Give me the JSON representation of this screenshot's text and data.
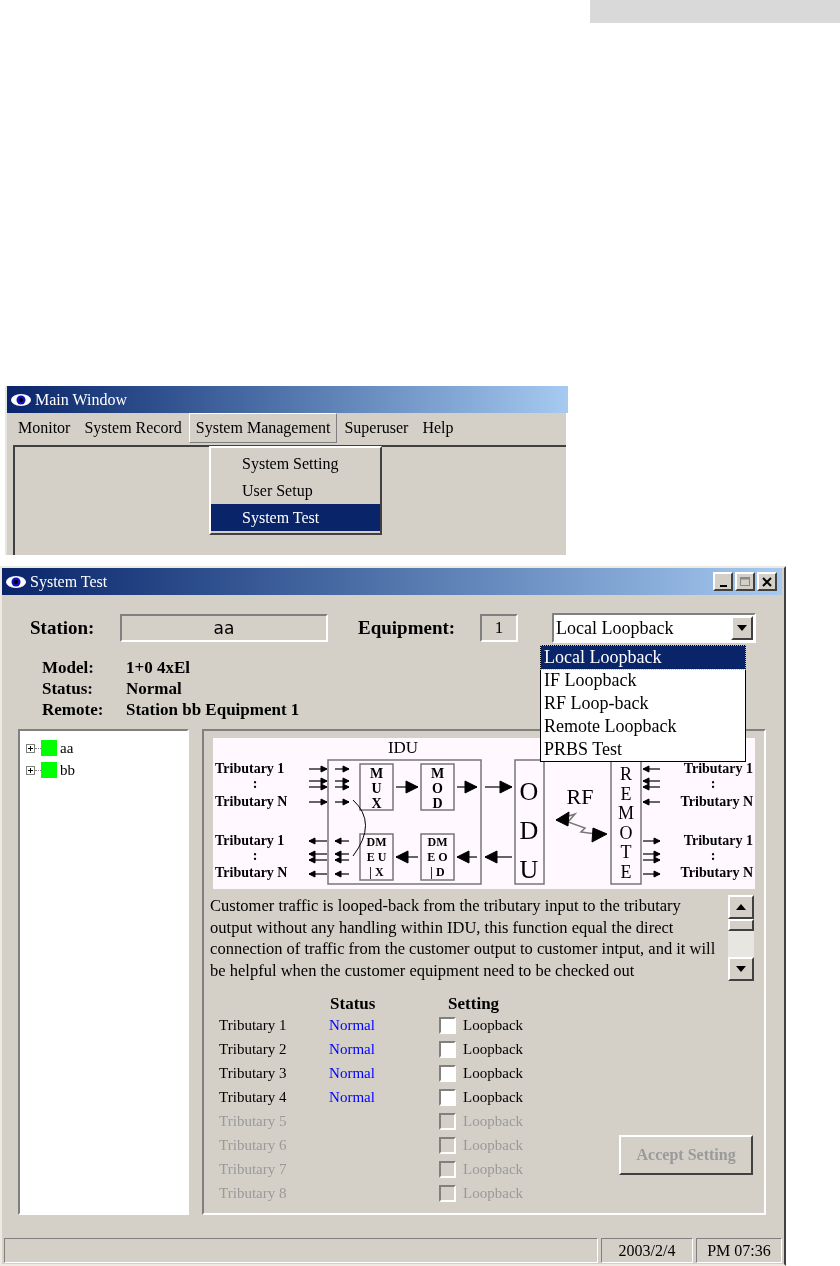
{
  "main_window": {
    "title": "Main Window",
    "menu": [
      {
        "label": "Monitor",
        "selected": false
      },
      {
        "label": "System Record",
        "selected": false
      },
      {
        "label": "System Management",
        "selected": true
      },
      {
        "label": "Superuser",
        "selected": false
      },
      {
        "label": "Help",
        "selected": false
      }
    ],
    "open_menu": [
      {
        "label": "System Setting",
        "selected": false
      },
      {
        "label": "User Setup",
        "selected": false
      },
      {
        "label": "System Test",
        "selected": true
      }
    ]
  },
  "system_test_window": {
    "title": "System Test",
    "station_label": "Station:",
    "station": "aa",
    "equipment_label": "Equipment:",
    "equipment": "1",
    "mode": "Local Loopback",
    "mode_options": [
      {
        "label": "Local Loopback",
        "selected": true
      },
      {
        "label": "IF Loopback",
        "selected": false
      },
      {
        "label": "RF Loop-back",
        "selected": false
      },
      {
        "label": "Remote Loopback",
        "selected": false
      },
      {
        "label": "PRBS Test",
        "selected": false
      }
    ],
    "info": [
      {
        "label": "Model:",
        "value": "1+0 4xEl"
      },
      {
        "label": "Status:",
        "value": "Normal"
      },
      {
        "label": "Remote:",
        "value": "Station bb Equipment 1"
      }
    ],
    "tree": [
      {
        "label": "aa",
        "expanded": false
      },
      {
        "label": "bb",
        "expanded": false
      }
    ],
    "diagram": {
      "idu": "IDU",
      "rf": "RF",
      "left_in": [
        "Tributary 1",
        ":",
        "Tributary N"
      ],
      "left_out": [
        "Tributary 1",
        ":",
        "Tributary N"
      ],
      "right_in": [
        "Tributary 1",
        ":",
        "Tributary N"
      ],
      "right_out": [
        "Tributary 1",
        ":",
        "Tributary N"
      ],
      "mux": [
        "M",
        "U",
        "X"
      ],
      "mod": [
        "M",
        "O",
        "D"
      ],
      "demux": [
        "DM",
        "E U",
        "| X"
      ],
      "demod": [
        "DM",
        "E O",
        "| D"
      ],
      "odu": [
        "O",
        "D",
        "U"
      ],
      "remote": [
        "R",
        "E",
        "M",
        "O",
        "T",
        "E"
      ]
    },
    "description": "Customer traffic is looped-back from the tributary input to the tributary output without any handling within IDU, this function equal the direct connection of traffic from the customer output to customer intput, and it will be helpful when the customer equipment need to be checked out",
    "columns": [
      "Status",
      "Setting"
    ],
    "rows": [
      {
        "name": "Tributary 1",
        "status": "Normal",
        "option": "Loopback",
        "checked": false,
        "disabled": false
      },
      {
        "name": "Tributary 2",
        "status": "Normal",
        "option": "Loopback",
        "checked": false,
        "disabled": false
      },
      {
        "name": "Tributary 3",
        "status": "Normal",
        "option": "Loopback",
        "checked": false,
        "disabled": false
      },
      {
        "name": "Tributary 4",
        "status": "Normal",
        "option": "Loopback",
        "checked": false,
        "disabled": false
      },
      {
        "name": "Tributary 5",
        "option": "Loopback",
        "checked": false,
        "disabled": true
      },
      {
        "name": "Tributary 6",
        "option": "Loopback",
        "checked": false,
        "disabled": true
      },
      {
        "name": "Tributary 7",
        "option": "Loopback",
        "checked": false,
        "disabled": true
      },
      {
        "name": "Tributary 8",
        "option": "Loopback",
        "checked": false,
        "disabled": true
      }
    ],
    "accept_button": {
      "label": "Accept Setting",
      "disabled": true
    },
    "status_bar": [
      "2003/2/4",
      "PM 07:36"
    ]
  }
}
